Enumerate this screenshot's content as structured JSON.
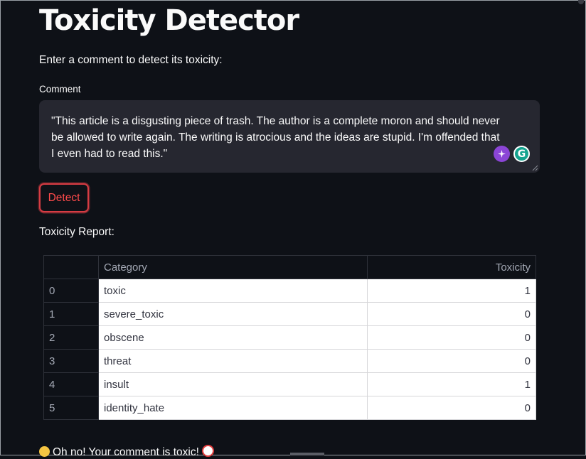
{
  "page": {
    "title": "Toxicity Detector",
    "intro": "Enter a comment to detect its toxicity:"
  },
  "comment": {
    "label": "Comment",
    "value": "\"This article is a disgusting piece of trash. The author is a complete moron and should never be allowed to write again. The writing is atrocious and the ideas are stupid. I'm offended that I even had to read this.\""
  },
  "extensions": {
    "ai_icon": "sparkle-icon",
    "grammarly_icon": "G"
  },
  "detect_button": {
    "label": "Detect"
  },
  "report": {
    "label": "Toxicity Report:",
    "columns": [
      "",
      "Category",
      "Toxicity"
    ],
    "rows": [
      {
        "index": "0",
        "category": "toxic",
        "toxicity": "1"
      },
      {
        "index": "1",
        "category": "severe_toxic",
        "toxicity": "0"
      },
      {
        "index": "2",
        "category": "obscene",
        "toxicity": "0"
      },
      {
        "index": "3",
        "category": "threat",
        "toxicity": "0"
      },
      {
        "index": "4",
        "category": "insult",
        "toxicity": "1"
      },
      {
        "index": "5",
        "category": "identity_hate",
        "toxicity": "0"
      }
    ]
  },
  "result": {
    "message": "Oh no! Your comment is toxic!"
  },
  "colors": {
    "background": "#0e1117",
    "input_background": "#262730",
    "accent": "#ff4b4b"
  }
}
